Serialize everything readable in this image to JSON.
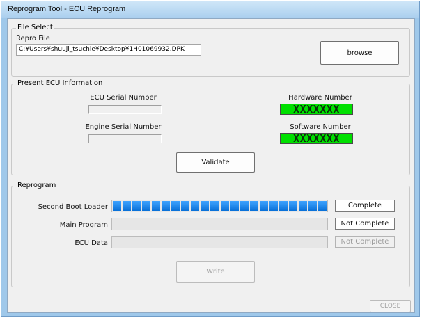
{
  "window": {
    "title": "Reprogram Tool - ECU Reprogram"
  },
  "file_select": {
    "legend": "File Select",
    "repro_label": "Repro File",
    "repro_value": "C:¥Users¥shuuji_tsuchie¥Desktop¥1H01069932.DPK",
    "browse_label": "browse"
  },
  "ecu_info": {
    "legend": "Present ECU Information",
    "ecu_serial_label": "ECU Serial Number",
    "ecu_serial_value": "",
    "engine_serial_label": "Engine Serial Number",
    "engine_serial_value": "",
    "hardware_label": "Hardware Number",
    "hardware_value": "XXXXXXX",
    "software_label": "Software Number",
    "software_value": "XXXXXXX",
    "status_color": "#00e000",
    "validate_label": "Validate"
  },
  "reprogram": {
    "legend": "Reprogram",
    "progress_color": "#1a86f0",
    "rows": [
      {
        "label": "Second Boot Loader",
        "progress": 1.0,
        "segments": 22,
        "status": "Complete",
        "status_enabled": true
      },
      {
        "label": "Main Program",
        "progress": 0.0,
        "segments": 22,
        "status": "Not Complete",
        "status_enabled": true
      },
      {
        "label": "ECU Data",
        "progress": 0.0,
        "segments": 22,
        "status": "Not Complete",
        "status_enabled": false
      }
    ],
    "write_label": "Write"
  },
  "footer": {
    "close_label": "CLOSE"
  }
}
